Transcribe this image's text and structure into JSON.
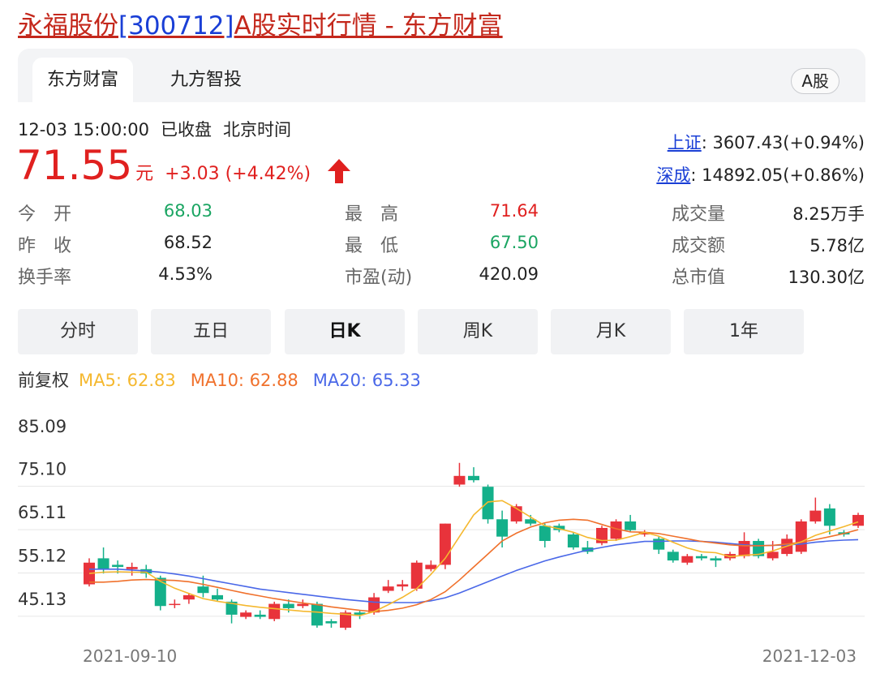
{
  "header": {
    "name": "永福股份",
    "code": "[300712]",
    "rest": "A股实时行情 - 东方财富"
  },
  "source_tabs": {
    "active": "东方财富",
    "other": "九方智投",
    "badge": "A股"
  },
  "quote": {
    "date": "12-03 15:00:00",
    "status": "已收盘",
    "tz": "北京时间",
    "price": "71.55",
    "unit": "元",
    "change": "+3.03 (+4.42%)",
    "direction": "up"
  },
  "indices": [
    {
      "name": "上证",
      "value": ": 3607.43(+0.94%)"
    },
    {
      "name": "深成",
      "value": ": 14892.05(+0.86%)"
    }
  ],
  "stats": {
    "open": {
      "label": "今　开",
      "value": "68.03"
    },
    "prev_close": {
      "label": "昨　收",
      "value": "68.52"
    },
    "turnover_rate": {
      "label": "换手率",
      "value": "4.53%"
    },
    "high": {
      "label": "最　高",
      "value": "71.64"
    },
    "low": {
      "label": "最　低",
      "value": "67.50"
    },
    "pe": {
      "label": "市盈(动)",
      "value": "420.09"
    },
    "volume": {
      "label": "成交量",
      "value": "8.25万手"
    },
    "amount": {
      "label": "成交额",
      "value": "5.78亿"
    },
    "market_cap": {
      "label": "总市值",
      "value": "130.30亿"
    }
  },
  "kline_tabs": [
    "分时",
    "五日",
    "日K",
    "周K",
    "月K",
    "1年"
  ],
  "kline_active": "日K",
  "ma_legend": {
    "adjust": "前复权",
    "ma5": "MA5: 62.83",
    "ma10": "MA10: 62.88",
    "ma20": "MA20: 65.33"
  },
  "colors": {
    "up": "#e8333b",
    "down": "#14b08a",
    "ma5": "#f5b82f",
    "ma10": "#f0712c",
    "ma20": "#4a68e8",
    "link": "#1a3fd6"
  },
  "chart_data": {
    "type": "candlestick",
    "ylim": [
      41,
      87
    ],
    "y_ticks": [
      "85.09",
      "75.10",
      "65.11",
      "55.12",
      "45.13"
    ],
    "y_tick_values": [
      85.09,
      75.1,
      65.11,
      55.12,
      45.13
    ],
    "x_labels": [
      "2021-09-10",
      "2021-12-03"
    ],
    "candles": [
      {
        "o": 52.5,
        "h": 58.5,
        "l": 52,
        "c": 57.5
      },
      {
        "o": 58.5,
        "h": 61,
        "l": 55,
        "c": 56
      },
      {
        "o": 57,
        "h": 58,
        "l": 55,
        "c": 56.5
      },
      {
        "o": 56,
        "h": 57.5,
        "l": 54.5,
        "c": 56.5
      },
      {
        "o": 56,
        "h": 57,
        "l": 54,
        "c": 55
      },
      {
        "o": 54,
        "h": 54.5,
        "l": 46.5,
        "c": 47.5
      },
      {
        "o": 48,
        "h": 49,
        "l": 47,
        "c": 48
      },
      {
        "o": 49,
        "h": 50.5,
        "l": 48,
        "c": 50
      },
      {
        "o": 52,
        "h": 54.5,
        "l": 49.5,
        "c": 50.5
      },
      {
        "o": 50,
        "h": 51.5,
        "l": 48.5,
        "c": 49
      },
      {
        "o": 48.5,
        "h": 49,
        "l": 43.5,
        "c": 45.5
      },
      {
        "o": 45,
        "h": 46.5,
        "l": 44.5,
        "c": 46
      },
      {
        "o": 45.5,
        "h": 46.5,
        "l": 44.5,
        "c": 45
      },
      {
        "o": 44.5,
        "h": 48.5,
        "l": 44,
        "c": 48
      },
      {
        "o": 48,
        "h": 49,
        "l": 46,
        "c": 47
      },
      {
        "o": 47.5,
        "h": 49,
        "l": 47,
        "c": 48
      },
      {
        "o": 48,
        "h": 48.5,
        "l": 42.5,
        "c": 43
      },
      {
        "o": 44,
        "h": 44.5,
        "l": 42.5,
        "c": 43.5
      },
      {
        "o": 42.5,
        "h": 46.5,
        "l": 42,
        "c": 46
      },
      {
        "o": 46,
        "h": 46.5,
        "l": 44.5,
        "c": 45.5
      },
      {
        "o": 46,
        "h": 50.5,
        "l": 45.5,
        "c": 49.5
      },
      {
        "o": 51,
        "h": 53.5,
        "l": 50.5,
        "c": 52
      },
      {
        "o": 52,
        "h": 53.5,
        "l": 51,
        "c": 52.5
      },
      {
        "o": 51.5,
        "h": 58,
        "l": 51,
        "c": 57.5
      },
      {
        "o": 56,
        "h": 58,
        "l": 55.5,
        "c": 57
      },
      {
        "o": 57,
        "h": 66.5,
        "l": 56,
        "c": 66.5
      },
      {
        "o": 75.5,
        "h": 80.5,
        "l": 75,
        "c": 77.5
      },
      {
        "o": 77.5,
        "h": 79.5,
        "l": 76,
        "c": 76.5
      },
      {
        "o": 75,
        "h": 75.5,
        "l": 66.5,
        "c": 67.5
      },
      {
        "o": 67.5,
        "h": 69.5,
        "l": 61,
        "c": 63.5
      },
      {
        "o": 67,
        "h": 71,
        "l": 66.5,
        "c": 70.5
      },
      {
        "o": 67.5,
        "h": 68.5,
        "l": 66,
        "c": 66.5
      },
      {
        "o": 66,
        "h": 66.5,
        "l": 61,
        "c": 62.5
      },
      {
        "o": 66,
        "h": 66.5,
        "l": 64.5,
        "c": 65
      },
      {
        "o": 64,
        "h": 64.5,
        "l": 60.5,
        "c": 61
      },
      {
        "o": 61,
        "h": 62.5,
        "l": 59.5,
        "c": 60
      },
      {
        "o": 62,
        "h": 66,
        "l": 61.5,
        "c": 65.5
      },
      {
        "o": 63,
        "h": 67.5,
        "l": 62.5,
        "c": 67
      },
      {
        "o": 67,
        "h": 68.5,
        "l": 64.5,
        "c": 65
      },
      {
        "o": 64,
        "h": 65,
        "l": 63.5,
        "c": 64.5
      },
      {
        "o": 63,
        "h": 63.5,
        "l": 59.5,
        "c": 60.5
      },
      {
        "o": 60,
        "h": 60.5,
        "l": 57.5,
        "c": 58
      },
      {
        "o": 57.5,
        "h": 59.5,
        "l": 57,
        "c": 59
      },
      {
        "o": 59,
        "h": 59.5,
        "l": 58,
        "c": 58.5
      },
      {
        "o": 58.5,
        "h": 59,
        "l": 56.5,
        "c": 58
      },
      {
        "o": 58.5,
        "h": 60,
        "l": 58,
        "c": 59.5
      },
      {
        "o": 59,
        "h": 64.5,
        "l": 58.5,
        "c": 62.5
      },
      {
        "o": 62.5,
        "h": 63,
        "l": 58.5,
        "c": 59
      },
      {
        "o": 58.5,
        "h": 62.5,
        "l": 58,
        "c": 60
      },
      {
        "o": 59.5,
        "h": 64,
        "l": 59,
        "c": 63
      },
      {
        "o": 60,
        "h": 67.5,
        "l": 59.5,
        "c": 67
      },
      {
        "o": 67,
        "h": 72.5,
        "l": 66.5,
        "c": 69.5
      },
      {
        "o": 70,
        "h": 71,
        "l": 64,
        "c": 66
      },
      {
        "o": 64.5,
        "h": 65,
        "l": 63.5,
        "c": 64
      },
      {
        "o": 66,
        "h": 69,
        "l": 65.5,
        "c": 68.5
      }
    ],
    "ma5": [
      55,
      55.3,
      55.4,
      55.3,
      55.3,
      53.2,
      51.6,
      50.4,
      49.2,
      48.6,
      48.1,
      47.6,
      47.2,
      46.9,
      46.6,
      46.3,
      46.1,
      45.8,
      45.6,
      45.3,
      46.2,
      47.8,
      49.5,
      51.5,
      54.8,
      58.5,
      63.5,
      68.5,
      71.5,
      71.8,
      70,
      68,
      66,
      65.3,
      64.5,
      63.3,
      62.6,
      62.7,
      63.5,
      64.5,
      63.6,
      62.2,
      60.9,
      60,
      59.8,
      58.9,
      59.2,
      59.4,
      60.2,
      61.3,
      62.3,
      63.8,
      64.8,
      65.8,
      66.9
    ],
    "ma10": [
      53,
      53,
      53.2,
      53.5,
      53.6,
      53.5,
      53.4,
      53.1,
      52.5,
      51.8,
      51.1,
      50.4,
      49.8,
      49.2,
      48.7,
      48.2,
      47.8,
      47.3,
      46.9,
      46.5,
      46.2,
      46.5,
      47,
      47.8,
      49,
      50.8,
      53.5,
      56.5,
      59.5,
      62.5,
      64.3,
      65.7,
      66.7,
      67.3,
      67.5,
      67.3,
      66.3,
      65.3,
      64.6,
      64.5,
      64.2,
      63.6,
      63,
      62.4,
      62,
      61.6,
      61.4,
      61.4,
      61.5,
      61.8,
      62.2,
      62.8,
      63.5,
      64.2,
      65.1
    ],
    "ma20": [
      56,
      56,
      56,
      55.8,
      55.6,
      55.3,
      54.9,
      54.4,
      53.8,
      53.2,
      52.6,
      52,
      51.4,
      51,
      50.6,
      50.2,
      49.8,
      49.4,
      49,
      48.7,
      48.4,
      48.3,
      48.3,
      48.3,
      48.7,
      49.4,
      50.5,
      51.8,
      53.1,
      54.4,
      55.7,
      56.8,
      57.9,
      58.8,
      59.6,
      60.4,
      61,
      61.6,
      62,
      62.4,
      62.4,
      62.5,
      62.5,
      62.4,
      62.2,
      61.9,
      61.6,
      61.4,
      61.5,
      61.6,
      61.8,
      62.2,
      62.5,
      62.7,
      62.8
    ]
  }
}
